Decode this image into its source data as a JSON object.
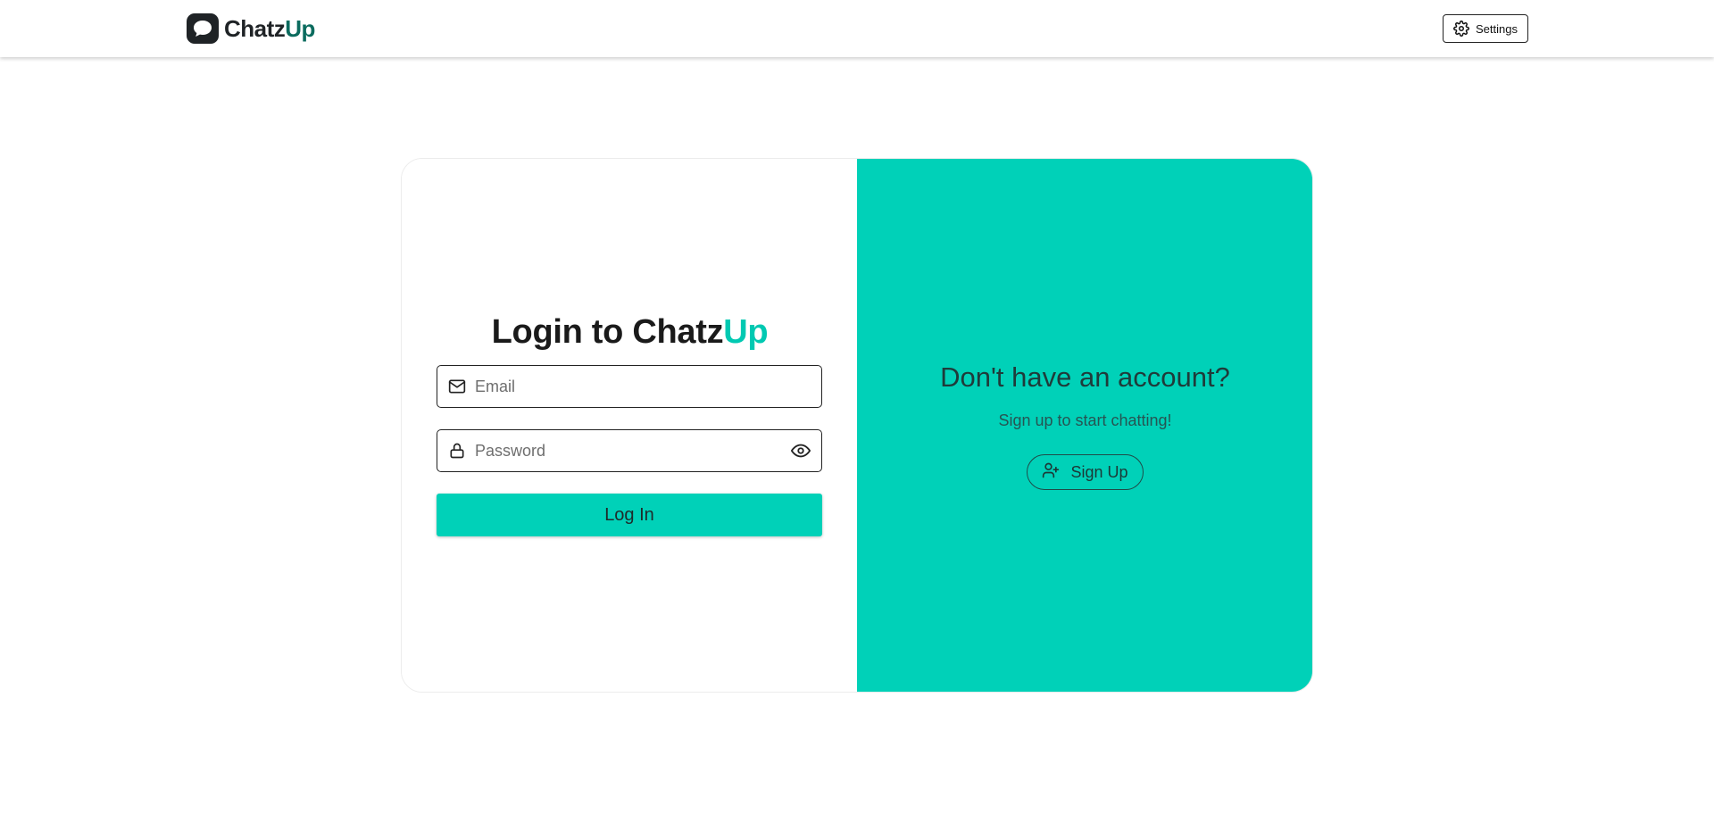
{
  "header": {
    "logo": {
      "text_main": "Chatz",
      "text_accent": "Up",
      "icon": "chat-bubble-icon"
    },
    "settings": {
      "label": "Settings",
      "icon": "gear-icon"
    }
  },
  "login": {
    "title_main": "Login to Chatz",
    "title_accent": "Up",
    "email": {
      "placeholder": "Email",
      "value": "",
      "icon": "mail-icon"
    },
    "password": {
      "placeholder": "Password",
      "value": "",
      "icon": "lock-icon",
      "toggle_icon": "eye-icon"
    },
    "submit_label": "Log In"
  },
  "promo": {
    "title": "Don't have an account?",
    "subtitle": "Sign up to start chatting!",
    "signup_label": "Sign Up",
    "signup_icon": "user-plus-icon"
  },
  "colors": {
    "accent": "#00d1b8",
    "accent_text": "#00c9b2",
    "logo_accent": "#0b6b5e",
    "dark": "#1f2326"
  }
}
